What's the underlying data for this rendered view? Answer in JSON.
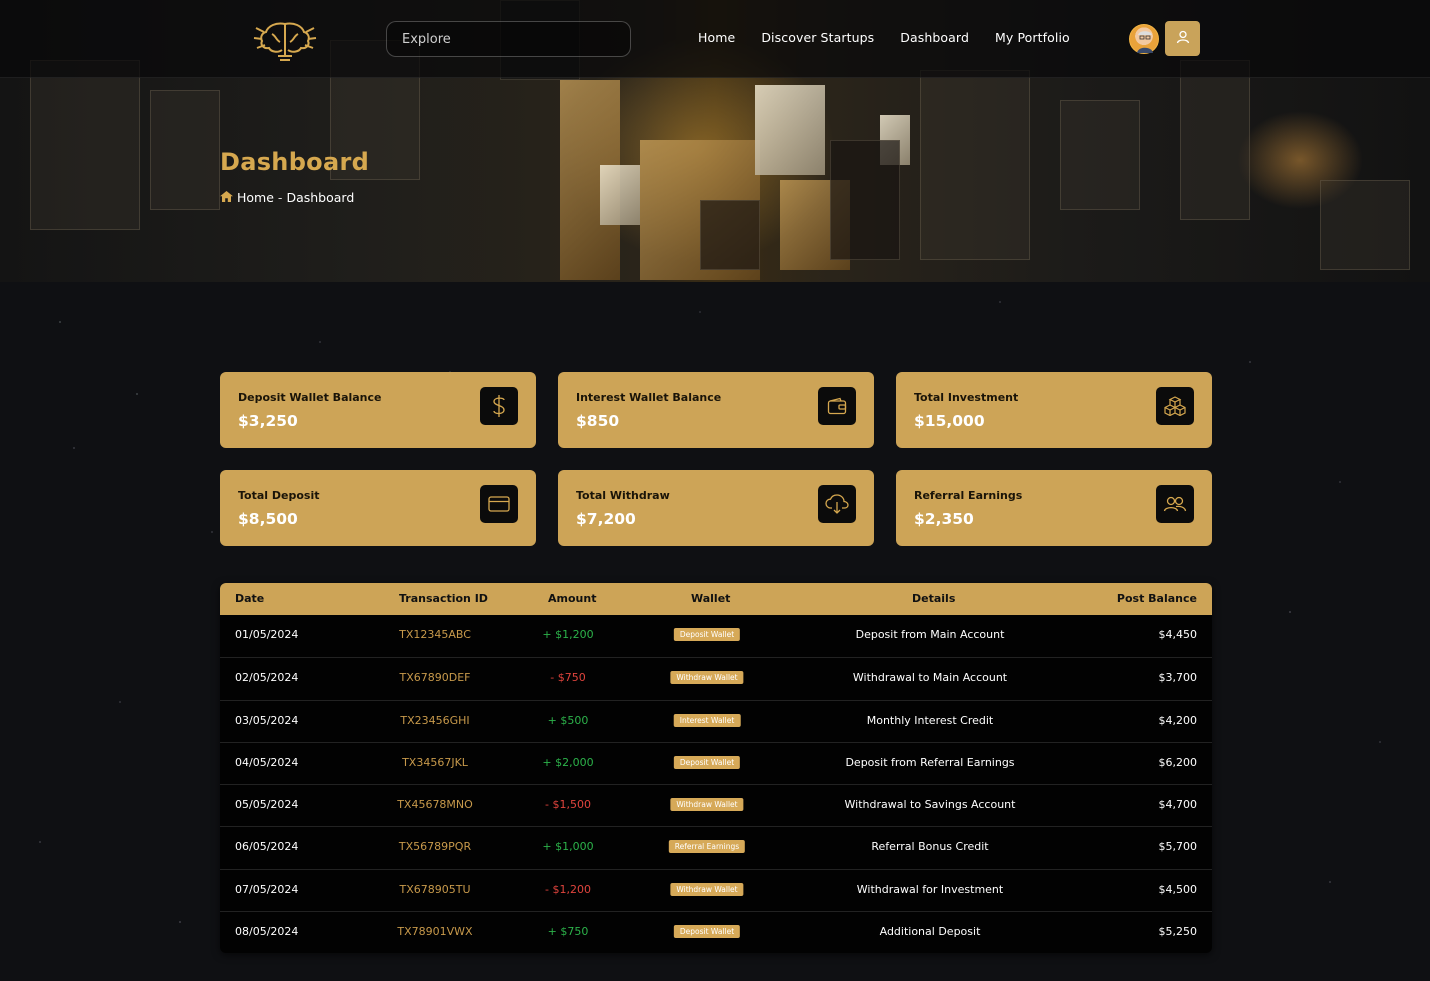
{
  "nav": {
    "search_placeholder": "Explore",
    "links": [
      "Home",
      "Discover Startups",
      "Dashboard",
      "My Portfolio"
    ]
  },
  "hero": {
    "title": "Dashboard",
    "breadcrumb_home": "Home",
    "breadcrumb_sep": "-",
    "breadcrumb_current": "Dashboard"
  },
  "cards": [
    {
      "label": "Deposit Wallet Balance",
      "value": "$3,250",
      "icon": "dollar-icon"
    },
    {
      "label": "Interest Wallet Balance",
      "value": "$850",
      "icon": "wallet-icon"
    },
    {
      "label": "Total Investment",
      "value": "$15,000",
      "icon": "boxes-icon"
    },
    {
      "label": "Total Deposit",
      "value": "$8,500",
      "icon": "credit-card-icon"
    },
    {
      "label": "Total Withdraw",
      "value": "$7,200",
      "icon": "cloud-download-icon"
    },
    {
      "label": "Referral Earnings",
      "value": "$2,350",
      "icon": "users-icon"
    }
  ],
  "table": {
    "headers": [
      "Date",
      "Transaction ID",
      "Amount",
      "Wallet",
      "Details",
      "Post Balance"
    ],
    "rows": [
      {
        "date": "01/05/2024",
        "tx": "TX12345ABC",
        "amount": "+ $1,200",
        "wallet": "Deposit Wallet",
        "details": "Deposit from Main Account",
        "balance": "$4,450"
      },
      {
        "date": "02/05/2024",
        "tx": "TX67890DEF",
        "amount": "- $750",
        "wallet": "Withdraw Wallet",
        "details": "Withdrawal to Main Account",
        "balance": "$3,700"
      },
      {
        "date": "03/05/2024",
        "tx": "TX23456GHI",
        "amount": "+ $500",
        "wallet": "Interest Wallet",
        "details": "Monthly Interest Credit",
        "balance": "$4,200"
      },
      {
        "date": "04/05/2024",
        "tx": "TX34567JKL",
        "amount": "+ $2,000",
        "wallet": "Deposit Wallet",
        "details": "Deposit from Referral Earnings",
        "balance": "$6,200"
      },
      {
        "date": "05/05/2024",
        "tx": "TX45678MNO",
        "amount": "- $1,500",
        "wallet": "Withdraw Wallet",
        "details": "Withdrawal to Savings Account",
        "balance": "$4,700"
      },
      {
        "date": "06/05/2024",
        "tx": "TX56789PQR",
        "amount": "+ $1,000",
        "wallet": "Referral Earnings",
        "details": "Referral Bonus Credit",
        "balance": "$5,700"
      },
      {
        "date": "07/05/2024",
        "tx": "TX678905TU",
        "amount": "- $1,200",
        "wallet": "Withdraw Wallet",
        "details": "Withdrawal for Investment",
        "balance": "$4,500"
      },
      {
        "date": "08/05/2024",
        "tx": "TX78901VWX",
        "amount": "+ $750",
        "wallet": "Deposit Wallet",
        "details": "Additional Deposit",
        "balance": "$5,250"
      }
    ]
  },
  "colors": {
    "accent": "#cda457",
    "positive": "#2cb24a",
    "negative": "#e0443d"
  }
}
